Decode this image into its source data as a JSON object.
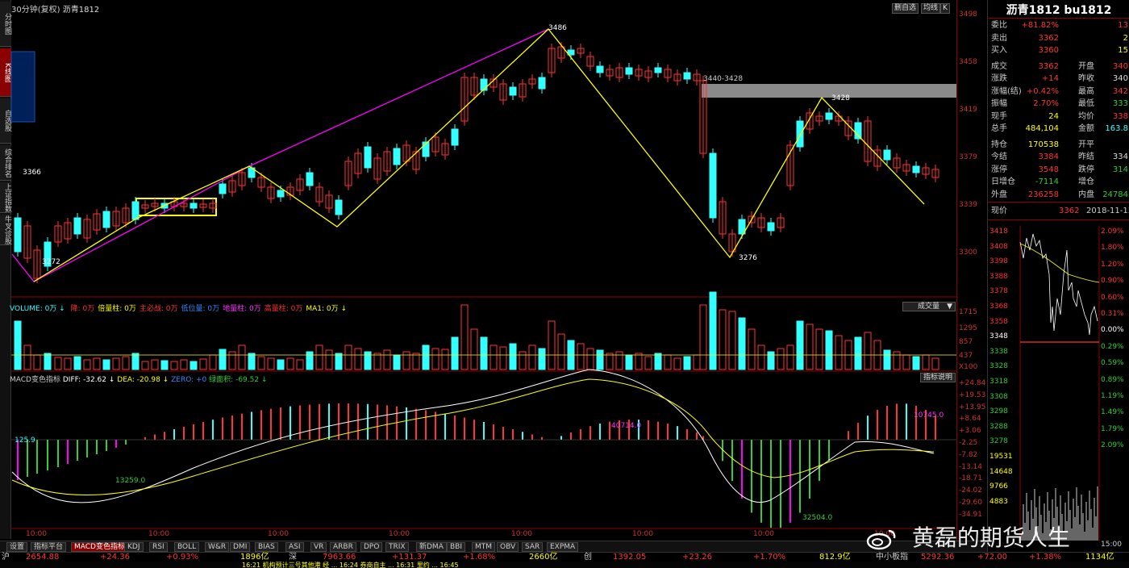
{
  "left_strip": [
    "分时图",
    "K线图",
    "自选股",
    "综合排名",
    "上证指数",
    "牛叉诊股"
  ],
  "window": {
    "title_period": "30分钟(复权)",
    "title_symbol": "沥青1812",
    "top_buttons": [
      "删自选",
      "均线",
      "K"
    ]
  },
  "price_axis": [
    "3498",
    "3458",
    "3419",
    "3379",
    "3339",
    "3300"
  ],
  "annotations": {
    "high": "3486",
    "low_left": "3272",
    "left_mark": "3366",
    "low_mid": "3276",
    "zone": "3440-3428",
    "right_peak": "3428"
  },
  "volume_header": {
    "text": "VOLUME: 0万 ↓",
    "items": [
      {
        "t": "降: 0万",
        "c": "#f33"
      },
      {
        "t": "倍量柱: 0万",
        "c": "#ff0"
      },
      {
        "t": "主必战: 0万",
        "c": "#f33"
      },
      {
        "t": "低位量: 0万",
        "c": "#38f"
      },
      {
        "t": "地量柱: 0万",
        "c": "#f3f"
      },
      {
        "t": "高量柱: 0万",
        "c": "#f33"
      },
      {
        "t": "MA1: 0万 ↓",
        "c": "#ff0"
      }
    ],
    "select": "成交量"
  },
  "volume_axis": [
    "1715",
    "1295",
    "857",
    "437",
    "X100"
  ],
  "macd_header": {
    "name": "MACD变色指标",
    "diff": "DIFF: -32.62 ↓",
    "dea": "DEA: -20.98 ↓",
    "zero": "ZERO: +0",
    "area": "绿面积: -69.52 ↓",
    "button": "指标说明"
  },
  "macd_axis": [
    "+24.84",
    "+19.53",
    "+13.95",
    "+8.64",
    "+3.06",
    "-2.25",
    "-7.82",
    "-13.14",
    "-18.71",
    "-24.02",
    "-29.60",
    "-34.91"
  ],
  "macd_labels": {
    "a": "13259.0",
    "b": "40714.0",
    "c": "32504.0",
    "d": "10745.0",
    "e": "125.9"
  },
  "time_axis": [
    "10:00",
    "10:00",
    "10:00",
    "10:00",
    "10:00",
    "10:00",
    "10:00",
    "10:00"
  ],
  "tabs": [
    "设置",
    "指标平台",
    "MACD变色指标",
    "KDJ",
    "RSI",
    "BOLL",
    "W&R",
    "DMI",
    "BIAS",
    "ASI",
    "VR",
    "ARBR",
    "DPO",
    "TRIX",
    "新DMA",
    "BBI",
    "MTM",
    "OBV",
    "SAR",
    "EXPMA"
  ],
  "market": [
    {
      "t": "沪",
      "c": "#ccc"
    },
    {
      "t": "2654.88",
      "c": "#f33"
    },
    {
      "t": "+24.36",
      "c": "#f33"
    },
    {
      "t": "+0.93%",
      "c": "#f33"
    },
    {
      "t": "1896亿",
      "c": "#ff0"
    },
    {
      "t": "深",
      "c": "#ccc"
    },
    {
      "t": "7963.66",
      "c": "#f33"
    },
    {
      "t": "+131.37",
      "c": "#f33"
    },
    {
      "t": "+1.68%",
      "c": "#f33"
    },
    {
      "t": "2660亿",
      "c": "#ff0"
    },
    {
      "t": "创",
      "c": "#ccc"
    },
    {
      "t": "1392.05",
      "c": "#f33"
    },
    {
      "t": "+23.26",
      "c": "#f33"
    },
    {
      "t": "+1.70%",
      "c": "#f33"
    },
    {
      "t": "812.9亿",
      "c": "#ff0"
    },
    {
      "t": "中小板指",
      "c": "#ccc"
    },
    {
      "t": "5292.36",
      "c": "#f33"
    },
    {
      "t": "+72.00",
      "c": "#f33"
    },
    {
      "t": "+1.38%",
      "c": "#f33"
    },
    {
      "t": "1134亿",
      "c": "#ff0"
    }
  ],
  "news": "16:21 机构预计三号其他港 经 ... 16:24 券商自主 ... 16:31 里约 ... 16:45",
  "quote": {
    "title": "沥青1812 bu1812",
    "rows": [
      {
        "l": "委比",
        "v": "+81.82%",
        "vc": "#f33",
        "l2": "",
        "v2": "13",
        "v2c": "#f33"
      },
      {
        "l": "卖出",
        "v": "3362",
        "vc": "#f33",
        "l2": "",
        "v2": "2",
        "v2c": "#ff0"
      },
      {
        "l": "买入",
        "v": "3360",
        "vc": "#f33",
        "l2": "",
        "v2": "15",
        "v2c": "#ff0"
      },
      {
        "l": "成交",
        "v": "3362",
        "vc": "#f33",
        "l2": "开盘",
        "v2": "340",
        "v2c": "#f33"
      },
      {
        "l": "涨跌",
        "v": "+14",
        "vc": "#f33",
        "l2": "昨收",
        "v2": "340",
        "v2c": "#ddd"
      },
      {
        "l": "涨幅(结)",
        "v": "+0.42%",
        "vc": "#f33",
        "l2": "最高",
        "v2": "342",
        "v2c": "#f33"
      },
      {
        "l": "振幅",
        "v": "2.70%",
        "vc": "#f33",
        "l2": "最低",
        "v2": "333",
        "v2c": "#3c3"
      },
      {
        "l": "现手",
        "v": "24",
        "vc": "#ff0",
        "l2": "均价",
        "v2": "338",
        "v2c": "#f33"
      },
      {
        "l": "总手",
        "v": "484,104",
        "vc": "#ff0",
        "l2": "金额",
        "v2": "163.8",
        "v2c": "#3ff"
      },
      {
        "l": "持仓",
        "v": "170538",
        "vc": "#ff0",
        "l2": "开平",
        "v2": "",
        "v2c": "#ddd"
      },
      {
        "l": "今结",
        "v": "3384",
        "vc": "#f33",
        "l2": "昨结",
        "v2": "334",
        "v2c": "#ddd"
      },
      {
        "l": "涨停",
        "v": "3548",
        "vc": "#f33",
        "l2": "跌停",
        "v2": "314",
        "v2c": "#3c3"
      },
      {
        "l": "日增仓",
        "v": "-7114",
        "vc": "#3c3",
        "l2": "增仓",
        "v2": "",
        "v2c": "#ddd"
      },
      {
        "l": "外盘",
        "v": "236258",
        "vc": "#f33",
        "l2": "内盘",
        "v2": "24784",
        "v2c": "#3c3"
      }
    ],
    "now_label": "现价",
    "now_value": "3362",
    "date": "2018-11-13",
    "mini_left": [
      "3418",
      "3408",
      "3398",
      "3388",
      "3378",
      "3368",
      "3358",
      "3348",
      "3338",
      "3328",
      "3318",
      "3308",
      "3298",
      "3288",
      "3278",
      "19531",
      "14648",
      "9766",
      "4883"
    ],
    "mini_right": [
      "2.09%",
      "1.80%",
      "1.20%",
      "0.90%",
      "0.60%",
      "0.31%",
      "0.00%",
      "0.29%",
      "0.59%",
      "0.89%",
      "1.19%",
      "1.49%",
      "1.79%",
      "2.09%"
    ],
    "mini_time": "15:00"
  },
  "watermark": "黄磊的期货人生"
}
